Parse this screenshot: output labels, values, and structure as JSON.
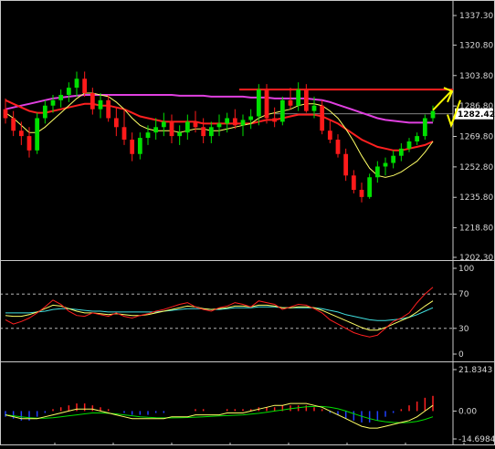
{
  "colors": {
    "background": "#000000",
    "frame": "#c8c8c8",
    "up_candle": "#00e000",
    "down_candle": "#ff1a1a",
    "ma_short": "#ffff66",
    "ma_mid": "#ff2020",
    "ma_long": "#e040e0",
    "rsi_fast": "#ff2020",
    "rsi_mid": "#ffff66",
    "rsi_slow": "#40e0e0",
    "macd_pos": "#ff2020",
    "macd_neg": "#2040ff",
    "macd_line": "#ffff66",
    "signal_line": "#00e000",
    "arrow": "#ffff00",
    "resistance": "#ff2020",
    "current_price_bg": "#ffffff"
  },
  "chart_data": [
    {
      "type": "candlestick",
      "name": "price",
      "y_ticks": [
        "1337.30",
        "1320.80",
        "1303.80",
        "1286.80",
        "1269.80",
        "1252.80",
        "1235.80",
        "1218.80",
        "1202.30"
      ],
      "ylim": [
        1202.3,
        1337.3
      ],
      "current_price_label": "1282.42",
      "current_price": 1282.42,
      "resistance_level": 1296.0,
      "ohlc": [
        [
          1285,
          1291,
          1277,
          1280
        ],
        [
          1280,
          1284,
          1270,
          1273
        ],
        [
          1273,
          1278,
          1265,
          1270
        ],
        [
          1270,
          1275,
          1258,
          1262
        ],
        [
          1262,
          1283,
          1260,
          1280
        ],
        [
          1280,
          1290,
          1277,
          1287
        ],
        [
          1287,
          1293,
          1283,
          1290
        ],
        [
          1290,
          1296,
          1286,
          1293
        ],
        [
          1293,
          1300,
          1289,
          1297
        ],
        [
          1297,
          1306,
          1292,
          1302
        ],
        [
          1302,
          1306,
          1292,
          1294
        ],
        [
          1294,
          1297,
          1282,
          1285
        ],
        [
          1285,
          1294,
          1280,
          1290
        ],
        [
          1290,
          1293,
          1278,
          1280
        ],
        [
          1280,
          1286,
          1270,
          1275
        ],
        [
          1275,
          1285,
          1265,
          1268
        ],
        [
          1268,
          1272,
          1256,
          1260
        ],
        [
          1260,
          1272,
          1257,
          1269
        ],
        [
          1269,
          1276,
          1265,
          1272
        ],
        [
          1272,
          1280,
          1268,
          1275
        ],
        [
          1275,
          1283,
          1270,
          1278
        ],
        [
          1278,
          1282,
          1266,
          1270
        ],
        [
          1270,
          1276,
          1265,
          1272
        ],
        [
          1272,
          1282,
          1268,
          1278
        ],
        [
          1278,
          1284,
          1272,
          1275
        ],
        [
          1275,
          1280,
          1266,
          1270
        ],
        [
          1270,
          1278,
          1266,
          1275
        ],
        [
          1275,
          1282,
          1270,
          1277
        ],
        [
          1277,
          1283,
          1272,
          1280
        ],
        [
          1280,
          1285,
          1274,
          1276
        ],
        [
          1276,
          1282,
          1270,
          1279
        ],
        [
          1279,
          1285,
          1274,
          1281
        ],
        [
          1281,
          1299,
          1276,
          1296
        ],
        [
          1296,
          1299,
          1277,
          1280
        ],
        [
          1280,
          1286,
          1275,
          1278
        ],
        [
          1278,
          1292,
          1276,
          1290
        ],
        [
          1290,
          1297,
          1285,
          1287
        ],
        [
          1287,
          1300,
          1284,
          1296
        ],
        [
          1296,
          1299,
          1283,
          1284
        ],
        [
          1284,
          1292,
          1280,
          1287
        ],
        [
          1287,
          1290,
          1271,
          1273
        ],
        [
          1273,
          1279,
          1266,
          1268
        ],
        [
          1268,
          1271,
          1258,
          1260
        ],
        [
          1260,
          1263,
          1245,
          1248
        ],
        [
          1248,
          1251,
          1238,
          1240
        ],
        [
          1240,
          1244,
          1233,
          1236
        ],
        [
          1236,
          1249,
          1235,
          1247
        ],
        [
          1247,
          1256,
          1244,
          1253
        ],
        [
          1253,
          1258,
          1248,
          1255
        ],
        [
          1255,
          1262,
          1252,
          1259
        ],
        [
          1259,
          1266,
          1256,
          1263
        ],
        [
          1263,
          1269,
          1261,
          1267
        ],
        [
          1267,
          1272,
          1265,
          1270
        ],
        [
          1270,
          1282,
          1268,
          1280
        ],
        [
          1280,
          1287,
          1278,
          1284
        ]
      ],
      "ma_short": [
        1283,
        1280,
        1276,
        1272,
        1272,
        1275,
        1279,
        1283,
        1287,
        1291,
        1294,
        1294,
        1293,
        1292,
        1289,
        1285,
        1280,
        1276,
        1274,
        1273,
        1273,
        1273,
        1272,
        1273,
        1274,
        1274,
        1273,
        1273,
        1274,
        1275,
        1276,
        1277,
        1280,
        1282,
        1283,
        1284,
        1285,
        1287,
        1288,
        1288,
        1287,
        1284,
        1280,
        1274,
        1267,
        1259,
        1252,
        1248,
        1247,
        1248,
        1250,
        1253,
        1256,
        1261,
        1267
      ],
      "ma_mid": [
        1290,
        1288,
        1286,
        1284,
        1283,
        1283,
        1284,
        1285,
        1286,
        1287,
        1288,
        1288,
        1287,
        1287,
        1286,
        1285,
        1283,
        1281,
        1280,
        1279,
        1278,
        1278,
        1278,
        1278,
        1278,
        1277,
        1277,
        1277,
        1277,
        1277,
        1277,
        1277,
        1278,
        1279,
        1279,
        1280,
        1281,
        1282,
        1282,
        1282,
        1281,
        1279,
        1277,
        1274,
        1271,
        1268,
        1266,
        1264,
        1263,
        1262,
        1262,
        1263,
        1264,
        1265,
        1267
      ],
      "ma_long": [
        1285,
        1286,
        1287,
        1288,
        1289,
        1290,
        1291,
        1291.5,
        1292,
        1292.5,
        1293,
        1293,
        1293,
        1293,
        1293,
        1293,
        1293,
        1293,
        1293,
        1293,
        1293,
        1293,
        1292.5,
        1292.5,
        1292.5,
        1292.5,
        1292,
        1292,
        1292,
        1292,
        1292,
        1291.5,
        1291.5,
        1291.5,
        1291,
        1291,
        1291,
        1291,
        1291,
        1290.5,
        1290,
        1289,
        1287.5,
        1286,
        1284.5,
        1283,
        1281.5,
        1280,
        1279,
        1278.5,
        1278,
        1277.5,
        1277.5,
        1277.5,
        1277.5
      ]
    },
    {
      "type": "line",
      "name": "oscillator",
      "y_ticks": [
        "100",
        "70",
        "30",
        "0"
      ],
      "ylim": [
        0,
        100
      ],
      "levels": [
        70,
        30
      ],
      "series_fast": [
        40,
        35,
        38,
        42,
        48,
        55,
        63,
        58,
        50,
        45,
        44,
        48,
        46,
        44,
        48,
        44,
        42,
        45,
        47,
        50,
        52,
        55,
        58,
        60,
        55,
        52,
        50,
        54,
        56,
        60,
        58,
        55,
        62,
        60,
        58,
        52,
        55,
        58,
        57,
        53,
        48,
        40,
        35,
        30,
        25,
        22,
        20,
        22,
        30,
        38,
        42,
        48,
        60,
        70,
        78
      ],
      "series_mid": [
        45,
        44,
        44,
        46,
        49,
        53,
        57,
        56,
        53,
        50,
        48,
        48,
        47,
        46,
        47,
        46,
        45,
        45,
        46,
        48,
        50,
        52,
        54,
        56,
        55,
        53,
        52,
        53,
        54,
        56,
        56,
        55,
        57,
        57,
        56,
        54,
        54,
        55,
        55,
        54,
        51,
        47,
        43,
        39,
        35,
        31,
        28,
        28,
        31,
        35,
        39,
        43,
        49,
        56,
        62
      ],
      "series_slow": [
        48,
        48,
        48,
        48,
        49,
        50,
        52,
        53,
        53,
        52,
        51,
        50,
        50,
        49,
        49,
        49,
        49,
        49,
        49,
        49,
        50,
        51,
        52,
        53,
        53,
        53,
        52,
        52,
        53,
        54,
        54,
        54,
        55,
        55,
        55,
        54,
        54,
        54,
        54,
        54,
        53,
        51,
        49,
        46,
        44,
        42,
        40,
        39,
        39,
        40,
        41,
        43,
        46,
        50,
        54
      ]
    },
    {
      "type": "bar",
      "name": "macd",
      "y_ticks": [
        "21.8343",
        "0.00",
        "-14.6984"
      ],
      "ylim": [
        -14.6984,
        21.8343
      ],
      "histogram": [
        -3,
        -4,
        -5,
        -5,
        -3,
        -1,
        1,
        2,
        3,
        4,
        4,
        3,
        2,
        1,
        0,
        -1,
        -2,
        -2,
        -2,
        -1,
        -1,
        0,
        0,
        0,
        1,
        1,
        0,
        0,
        1,
        1,
        1,
        1,
        2,
        2,
        2,
        3,
        3,
        3,
        3,
        2,
        1,
        -1,
        -2,
        -4,
        -5,
        -6,
        -6,
        -5,
        -3,
        -1,
        1,
        3,
        5,
        7,
        8
      ],
      "macd_line": [
        -2,
        -3,
        -4,
        -4,
        -4,
        -3,
        -2,
        -1,
        0,
        1,
        1,
        1,
        0,
        -1,
        -2,
        -3,
        -4,
        -4,
        -4,
        -4,
        -4,
        -3,
        -3,
        -3,
        -2,
        -2,
        -2,
        -2,
        -1,
        -1,
        -1,
        0,
        1,
        2,
        3,
        3,
        4,
        4,
        4,
        3,
        2,
        0,
        -2,
        -4,
        -6,
        -8,
        -9,
        -9,
        -8,
        -7,
        -6,
        -5,
        -3,
        0,
        3
      ],
      "signal_line": [
        -2,
        -2.5,
        -3,
        -3.5,
        -3.8,
        -3.8,
        -3.5,
        -3,
        -2.5,
        -2,
        -1.5,
        -1,
        -1,
        -1.2,
        -1.5,
        -2,
        -2.5,
        -3,
        -3.3,
        -3.5,
        -3.6,
        -3.6,
        -3.5,
        -3.4,
        -3.2,
        -3,
        -2.8,
        -2.6,
        -2.4,
        -2.2,
        -2,
        -1.6,
        -1.2,
        -0.6,
        0,
        0.6,
        1.2,
        1.8,
        2.2,
        2.4,
        2.4,
        2,
        1.2,
        0,
        -1.4,
        -2.8,
        -4,
        -5,
        -5.6,
        -6,
        -6.2,
        -6,
        -5.4,
        -4.4,
        -3
      ]
    }
  ]
}
